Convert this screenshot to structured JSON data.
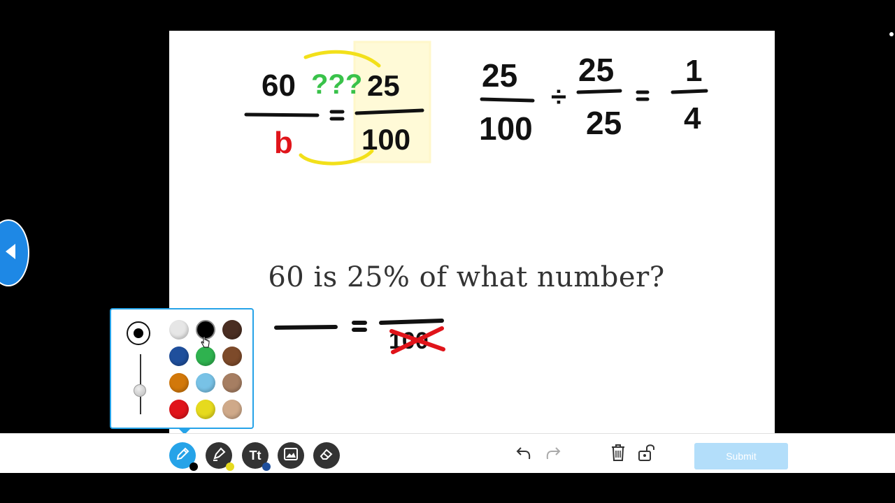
{
  "board": {
    "question": "60 is 25% of what number?"
  },
  "palette": {
    "colors": [
      {
        "name": "white",
        "hex": "#e6e6e6"
      },
      {
        "name": "black",
        "hex": "#000000"
      },
      {
        "name": "dark-brown",
        "hex": "#4a2e22"
      },
      {
        "name": "blue",
        "hex": "#1f4f9c"
      },
      {
        "name": "green",
        "hex": "#2fb24f"
      },
      {
        "name": "brown",
        "hex": "#7d4a2a"
      },
      {
        "name": "orange",
        "hex": "#d2780a"
      },
      {
        "name": "light-blue",
        "hex": "#78c2e6"
      },
      {
        "name": "tan",
        "hex": "#a67e62"
      },
      {
        "name": "red",
        "hex": "#e0141a"
      },
      {
        "name": "yellow",
        "hex": "#e6da1e"
      },
      {
        "name": "beige",
        "hex": "#cfa989"
      }
    ],
    "selected": "black"
  },
  "toolbar": {
    "tools": [
      "pen-icon",
      "highlighter-icon",
      "text-icon",
      "image-icon",
      "eraser-icon"
    ],
    "submit_label": "Submit",
    "accent": "#26a3e8"
  }
}
